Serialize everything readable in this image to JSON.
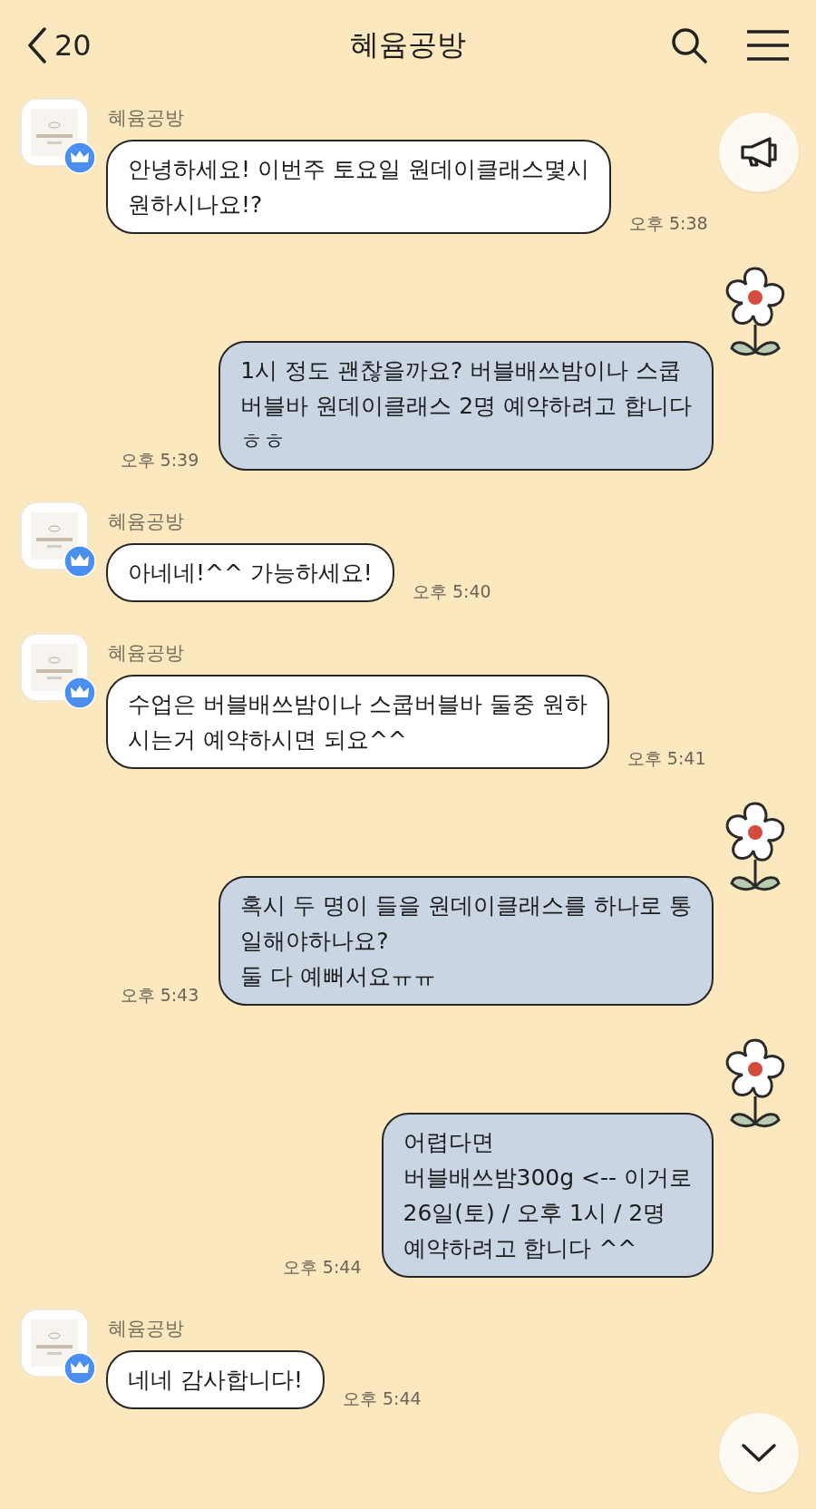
{
  "header": {
    "back_count": "20",
    "title": "혜윰공방"
  },
  "messages": [
    {
      "kind": "received",
      "sender": "혜윰공방",
      "text": "안녕하세요! 이번주 토요일 원데이클래스몇시\n원하시나요!?",
      "time": "오후 5:38"
    },
    {
      "kind": "sent",
      "text": "1시 정도 괜찮을까요? 버블배쓰밤이나 스쿱\n버블바 원데이클래스 2명 예약하려고 합니다\nㅎㅎ",
      "time": "오후 5:39"
    },
    {
      "kind": "received",
      "sender": "혜윰공방",
      "text": "아네네!^^ 가능하세요!",
      "time": "오후 5:40"
    },
    {
      "kind": "received",
      "sender": "혜윰공방",
      "text": "수업은 버블배쓰밤이나 스쿱버블바 둘중 원하\n시는거 예약하시면 되요^^",
      "time": "오후 5:41"
    },
    {
      "kind": "sent",
      "text": "혹시 두 명이 들을 원데이클래스를 하나로 통\n일해야하나요?\n둘 다 예뻐서요ㅠㅠ",
      "time": "오후 5:43"
    },
    {
      "kind": "sent",
      "text": "어렵다면\n버블배쓰밤300g <-- 이거로\n26일(토) / 오후 1시 / 2명\n예약하려고 합니다 ^^",
      "time": "오후 5:44"
    },
    {
      "kind": "received",
      "sender": "혜윰공방",
      "text": "네네 감사합니다!",
      "time": "오후 5:44"
    }
  ]
}
